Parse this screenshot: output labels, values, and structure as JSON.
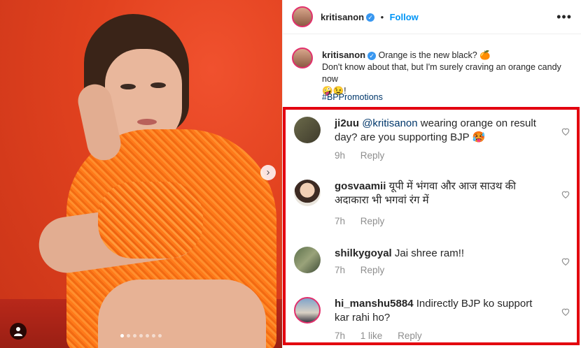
{
  "post": {
    "username": "kritisanon",
    "follow_label": "Follow",
    "more_label": "•••",
    "next_label": "›",
    "caption_line1": "Orange is the new black? 🍊",
    "caption_line2": "Don't know about that, but I'm surely craving an orange candy now",
    "caption_line3": "🤪😉!",
    "hashtag": "#BPPromotions"
  },
  "comments": [
    {
      "username": "ji2uu",
      "mention": "@kritisanon",
      "text": "wearing orange on result day? are you supporting BJP 🥵",
      "time": "9h",
      "likes": "",
      "reply_label": "Reply"
    },
    {
      "username": "gosvaamii",
      "mention": "",
      "text": "यूपी में भंगवा और आज साउथ की अदाकारा भी भगवां रंग में",
      "time": "7h",
      "likes": "",
      "reply_label": "Reply"
    },
    {
      "username": "shilkygoyal",
      "mention": "",
      "text": "Jai shree ram!!",
      "time": "7h",
      "likes": "",
      "reply_label": "Reply"
    },
    {
      "username": "hi_manshu5884",
      "mention": "",
      "text": "Indirectly BJP ko support kar rahi ho?",
      "time": "7h",
      "likes": "1 like",
      "reply_label": "Reply"
    }
  ],
  "colors": {
    "highlight_border": "#e3000f",
    "link_blue": "#0095f6",
    "verified_blue": "#3897f0",
    "dress_orange": "#ff7a1a"
  },
  "icons": {
    "verified": "verified-badge-icon",
    "heart": "heart-icon",
    "user_tag": "user-tag-icon",
    "next": "chevron-right-icon",
    "more": "more-options-icon"
  },
  "carousel": {
    "total": 7,
    "current": 1
  }
}
